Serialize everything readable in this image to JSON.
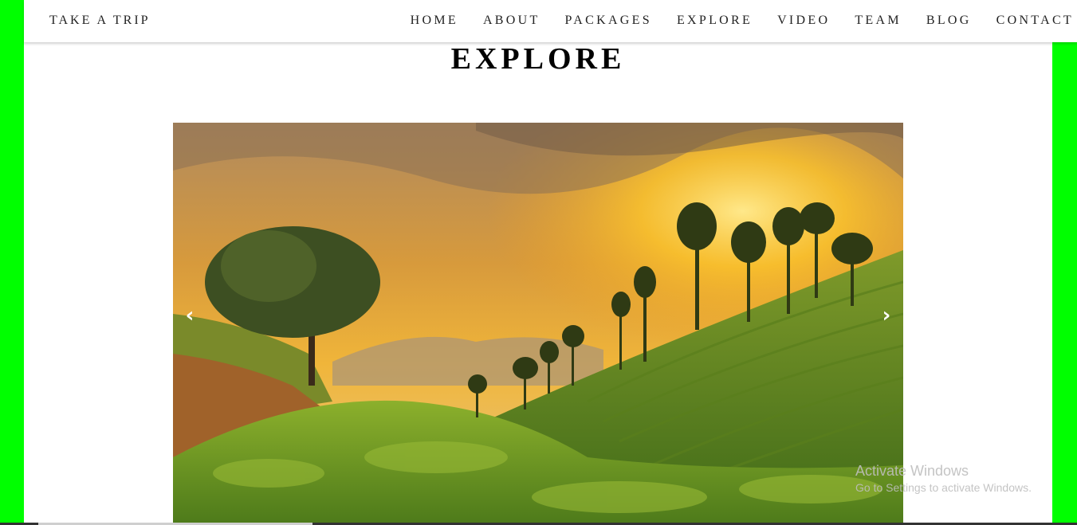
{
  "brand": "TAKE A TRIP",
  "nav": {
    "items": [
      "HOME",
      "ABOUT",
      "PACKAGES",
      "EXPLORE",
      "VIDEO",
      "TEAM",
      "BLOG",
      "CONTACT"
    ]
  },
  "section": {
    "title": "EXPLORE"
  },
  "carousel": {
    "prev_icon": "chevron-left-icon",
    "next_icon": "chevron-right-icon",
    "prev_glyph": "‹",
    "next_glyph": "›"
  },
  "watermark": {
    "title": "Activate Windows",
    "subtitle": "Go to Settings to activate Windows."
  },
  "colors": {
    "side_background": "#00ff00",
    "page_background": "#ffffff",
    "text": "#222222"
  }
}
